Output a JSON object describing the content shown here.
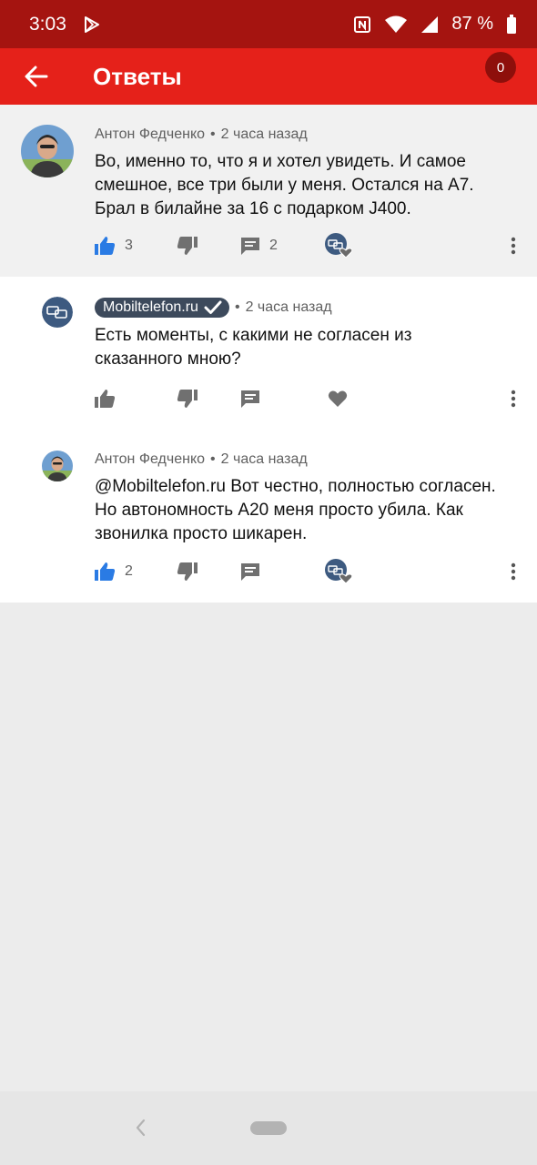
{
  "status_bar": {
    "time": "3:03",
    "battery": "87 %",
    "icons": [
      "play-store-icon",
      "nfc-icon",
      "wifi-icon",
      "signal-icon",
      "battery-icon"
    ]
  },
  "app_bar": {
    "title": "Ответы",
    "count": "0",
    "colors": {
      "status_bar": "#a51410",
      "app_bar": "#e5211a",
      "badge": "#8e0f0b"
    }
  },
  "comments": [
    {
      "author": "Антон Федченко",
      "time": "2 часа назад",
      "text": "Во, именно то, что я и хотел увидеть. И самое смешное, все три были у меня. Остался на А7. Брал в билайне за 16 с подарком J400.",
      "likes": "3",
      "replies": "2",
      "liked": true,
      "creator_heart": true
    },
    {
      "author": "Mobiltelefon.ru",
      "verified": true,
      "time": "2 часа назад",
      "text": "Есть моменты, с какими не согласен из сказанного мною?",
      "likes": "",
      "replies": "",
      "liked": false,
      "creator_heart": false
    },
    {
      "author": "Антон Федченко",
      "time": "2 часа назад",
      "text": "@Mobiltelefon.ru Вот честно, полностью согласен. Но автономность А20 меня просто убила. Как звонилка просто шикарен.",
      "likes": "2",
      "replies": "",
      "liked": true,
      "creator_heart": true
    }
  ],
  "separator": "•"
}
